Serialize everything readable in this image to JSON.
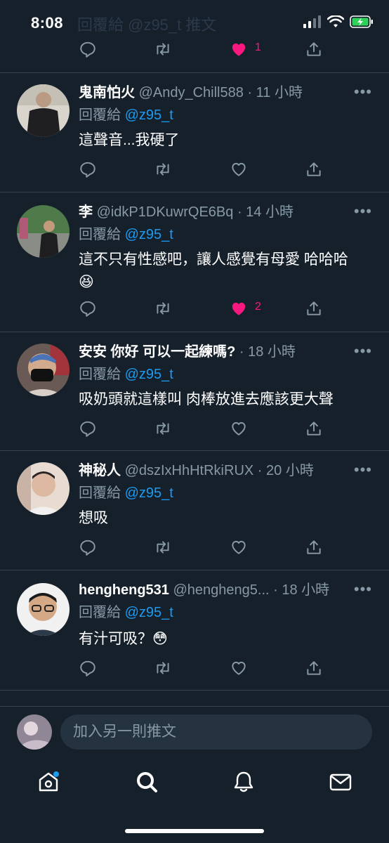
{
  "status_bar": {
    "time": "8:08",
    "ghost_text": "回覆給 @z95_t 推文"
  },
  "top_actions": {
    "like_count": "1"
  },
  "tweets": [
    {
      "name": "鬼南怕火",
      "handle": "@Andy_Chill588",
      "time": "· 11 小時",
      "reply_label": "回覆給",
      "reply_to": "@z95_t",
      "text": "這聲音...我硬了",
      "liked": false,
      "like_count": ""
    },
    {
      "name": "李",
      "handle": "@idkP1DKuwrQE6Bq",
      "time": "· 14 小時",
      "reply_label": "回覆給",
      "reply_to": "@z95_t",
      "text": "這不只有性感吧，讓人感覺有母愛 哈哈哈",
      "emoji": "😆",
      "liked": true,
      "like_count": "2"
    },
    {
      "name": "安安 你好 可以一起練嗎?",
      "handle": "",
      "time": "· 18 小時",
      "reply_label": "回覆給",
      "reply_to": "@z95_t",
      "text": "吸奶頭就這樣叫 肉棒放進去應該更大聲",
      "liked": false,
      "like_count": ""
    },
    {
      "name": "神秘人",
      "handle": "@dszIxHhHtRkiRUX",
      "time": "· 20 小時",
      "reply_label": "回覆給",
      "reply_to": "@z95_t",
      "text": "想吸",
      "liked": false,
      "like_count": ""
    },
    {
      "name": "hengheng531",
      "handle": "@hengheng5...",
      "time": "· 18 小時",
      "reply_label": "回覆給",
      "reply_to": "@z95_t",
      "text": "有汁可吸？😳",
      "liked": false,
      "like_count": ""
    }
  ],
  "compose": {
    "placeholder": "加入另一則推文"
  },
  "colors": {
    "background": "#15202b",
    "accent": "#1d9bf0",
    "like": "#f91880",
    "muted": "#8899a6",
    "divider": "#38444d"
  },
  "icons": [
    "reply-icon",
    "retweet-icon",
    "like-icon",
    "share-icon",
    "more-icon",
    "home-icon",
    "search-icon",
    "notifications-icon",
    "messages-icon"
  ]
}
